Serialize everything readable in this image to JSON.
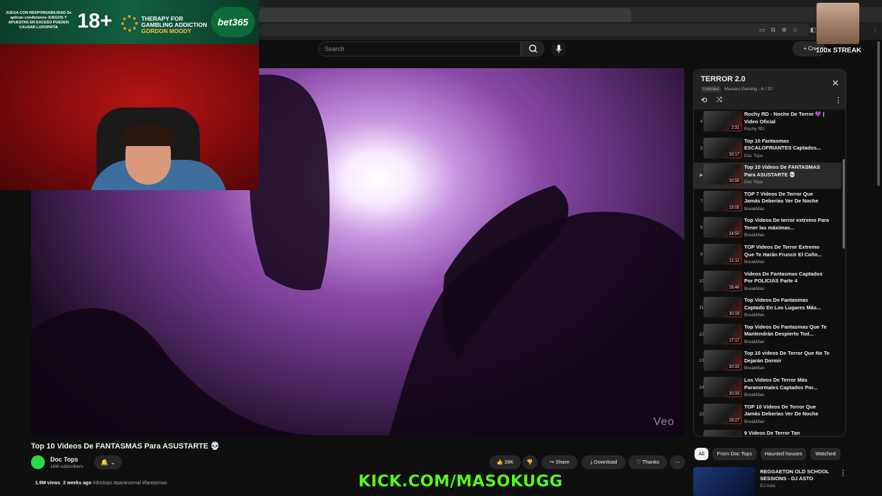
{
  "search": {
    "placeholder": "Search"
  },
  "header": {
    "create_label": "+ Create"
  },
  "ad": {
    "small_text": "JUEGA CON RESPONSABILIDAD Se aplican condiciones JUEGOS Y APUESTAS EN EXCESO PUEDEN CAUSAR LUDOPATÍA",
    "age": "18+",
    "therapy_line1": "THERAPY FOR",
    "therapy_line2": "GAMBLING ADDICTION",
    "therapy_line3": "GORDON MOODY",
    "brand": "bet365"
  },
  "overlay": {
    "streak": "100x STREAK",
    "kick": "KICK.COM/MASOKUGG",
    "watermark": "Veo"
  },
  "video": {
    "title": "Top 10 Videos De FANTASMAS Para ASUSTARTE 💀",
    "channel": "Doc Tops",
    "subscribers": "16M subscribers",
    "views": "1.9M views",
    "age": "2 weeks ago",
    "tags": "#doctops #paranormal #fantasmas",
    "likes": "39K",
    "share_label": "Share",
    "download_label": "Download",
    "thanks_label": "Thanks"
  },
  "playlist": {
    "title": "TERROR 2.0",
    "visibility": "Unlisted",
    "owner": "Masoku Gaming",
    "position": "6 / 20",
    "items": [
      {
        "index": "4",
        "title": "Rochy RD - Noche De Terror 💜 | Video Oficial",
        "channel": "Rochy RD",
        "duration": "2:31"
      },
      {
        "index": "5",
        "title": "Top 10 Fantasmas ESCALOFRIANTES Captados...",
        "channel": "Doc Tops",
        "duration": "30:17"
      },
      {
        "index": "▶",
        "title": "Top 10 Videos De FANTASMAS Para ASUSTARTE 💀",
        "channel": "Doc Tops",
        "duration": "30:55"
      },
      {
        "index": "7",
        "title": "TOP 7 Videos De Terror Que Jamás Deberías Ver De Noche",
        "channel": "BreakMan",
        "duration": "23:05"
      },
      {
        "index": "8",
        "title": "Top Videos De terror extremo Para Tener las máximas...",
        "channel": "BreakMan",
        "duration": "24:50"
      },
      {
        "index": "9",
        "title": "TOP Videos De Terror Extremo Que Te Harán Fruncir El Coño...",
        "channel": "BreakMan",
        "duration": "21:11"
      },
      {
        "index": "10",
        "title": "Videos De Fantasmas Captados Por POLICIAS Parte 4",
        "channel": "BreakMan",
        "duration": "26:46"
      },
      {
        "index": "11",
        "title": "Top Videos De Fantasmas Captado En Los Lugares Más...",
        "channel": "BreakMan",
        "duration": "30:19"
      },
      {
        "index": "12",
        "title": "Top Videos De Fantasmas Que Te Mantendrán Despierto Tod...",
        "channel": "BreakMan",
        "duration": "27:17"
      },
      {
        "index": "13",
        "title": "Top 10 videos De Terror Que No Te Dejarán Dormir",
        "channel": "BreakMan",
        "duration": "30:33"
      },
      {
        "index": "14",
        "title": "Los Videos De Terror Más Paranormales Captados Por...",
        "channel": "BreakMan",
        "duration": "30:33"
      },
      {
        "index": "15",
        "title": "TOP 10 Videos De Terror Que Jamás Deberías Ver De Noche",
        "channel": "BreakMan",
        "duration": "29:27"
      },
      {
        "index": "16",
        "title": "9 Videos De Terror Tan",
        "channel": "",
        "duration": ""
      }
    ]
  },
  "chips": [
    "All",
    "From Doc Tops",
    "Haunted houses",
    "Watched"
  ],
  "recommended": {
    "title": "REGGAETON OLD SCHOOL SESSIONS - DJ ASTO",
    "channel": "DJ Asto"
  }
}
